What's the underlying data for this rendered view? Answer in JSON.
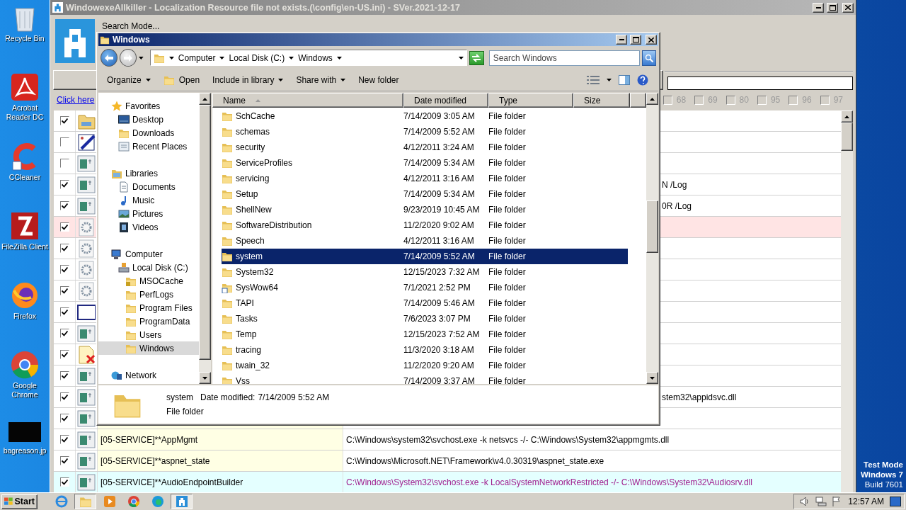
{
  "desktop_icons": [
    {
      "label": "Recycle Bin",
      "kind": "recycle"
    },
    {
      "label": "Acrobat Reader DC",
      "kind": "acrobat"
    },
    {
      "label": "CCleaner",
      "kind": "ccleaner"
    },
    {
      "label": "FileZilla Client",
      "kind": "filezilla"
    },
    {
      "label": "Firefox",
      "kind": "firefox"
    },
    {
      "label": "Google Chrome",
      "kind": "chrome"
    },
    {
      "label": "bagreason.jp",
      "kind": "image"
    }
  ],
  "app": {
    "title": "WindowexeAllkiller - Localization Resource file not exists.(\\config\\en-US.ini) - SVer.2021-12-17",
    "menu": "Search Mode...",
    "link": "Click here",
    "filters": [
      {
        "label": "68",
        "checked": false,
        "disabled": true
      },
      {
        "label": "69",
        "checked": false,
        "disabled": true
      },
      {
        "label": "80",
        "checked": false,
        "disabled": true
      },
      {
        "label": "95",
        "checked": false,
        "disabled": true
      },
      {
        "label": "96",
        "checked": false,
        "disabled": true
      },
      {
        "label": "97",
        "checked": false,
        "disabled": true
      }
    ],
    "rows": [
      {
        "checked": true,
        "kind": "plain",
        "icon": {
          "kind": "folder"
        }
      },
      {
        "checked": false,
        "kind": "plain",
        "icon": {
          "kind": "paint"
        }
      },
      {
        "checked": false,
        "kind": "plain",
        "icon": {
          "kind": "window"
        }
      },
      {
        "checked": true,
        "kind": "plain",
        "icon": {
          "kind": "window"
        },
        "path": "N /Log"
      },
      {
        "checked": true,
        "kind": "plain",
        "icon": {
          "kind": "window"
        },
        "path": "0R /Log"
      },
      {
        "checked": true,
        "kind": "flagged",
        "icon": {
          "kind": "gear"
        }
      },
      {
        "checked": true,
        "kind": "plain",
        "icon": {
          "kind": "gear"
        }
      },
      {
        "checked": true,
        "kind": "plain",
        "icon": {
          "kind": "gear"
        }
      },
      {
        "checked": true,
        "kind": "plain",
        "icon": {
          "kind": "gear"
        }
      },
      {
        "checked": true,
        "kind": "plain",
        "icon": {
          "kind": "blank"
        }
      },
      {
        "checked": true,
        "kind": "plain",
        "icon": {
          "kind": "window"
        }
      },
      {
        "checked": true,
        "kind": "plain",
        "icon": {
          "kind": "docx"
        }
      },
      {
        "checked": true,
        "kind": "plain",
        "icon": {
          "kind": "window"
        }
      },
      {
        "checked": true,
        "kind": "plain",
        "icon": {
          "kind": "window"
        },
        "path": "stem32\\appidsvc.dll"
      },
      {
        "checked": true,
        "kind": "service",
        "icon": {
          "kind": "window"
        }
      },
      {
        "checked": true,
        "kind": "service",
        "icon": {
          "kind": "window"
        },
        "name": "[05-SERVICE]**AppMgmt",
        "path": "C:\\Windows\\system32\\svchost.exe -k netsvcs -/- C:\\Windows\\System32\\appmgmts.dll"
      },
      {
        "checked": true,
        "kind": "service",
        "icon": {
          "kind": "window"
        },
        "name": "[05-SERVICE]**aspnet_state",
        "path": "C:\\Windows\\Microsoft.NET\\Framework\\v4.0.30319\\aspnet_state.exe"
      },
      {
        "checked": true,
        "kind": "restricted",
        "icon": {
          "kind": "window"
        },
        "name": "[05-SERVICE]**AudioEndpointBuilder",
        "path": "C:\\Windows\\System32\\svchost.exe -k LocalSystemNetworkRestricted -/- C:\\Windows\\System32\\Audiosrv.dll"
      }
    ]
  },
  "explorer": {
    "title": "Windows",
    "breadcrumb": [
      "Computer",
      "Local Disk (C:)",
      "Windows"
    ],
    "search": {
      "placeholder": "Search Windows"
    },
    "toolbar": [
      {
        "label": "Organize",
        "kind": "menu"
      },
      {
        "label": "Open",
        "kind": "icon"
      },
      {
        "label": "Include in library",
        "kind": "menu"
      },
      {
        "label": "Share with",
        "kind": "menu"
      },
      {
        "label": "New folder",
        "kind": "plain"
      }
    ],
    "nav": [
      {
        "label": "Favorites",
        "kind": "star",
        "selected": false,
        "children": [
          {
            "label": "Desktop",
            "kind": "desktop",
            "selected": false
          },
          {
            "label": "Downloads",
            "kind": "downloads",
            "selected": false
          },
          {
            "label": "Recent Places",
            "kind": "recent",
            "selected": false
          }
        ]
      },
      {
        "label": "Libraries",
        "kind": "library",
        "selected": false,
        "children": [
          {
            "label": "Documents",
            "kind": "document",
            "selected": false
          },
          {
            "label": "Music",
            "kind": "music",
            "selected": false
          },
          {
            "label": "Pictures",
            "kind": "picture",
            "selected": false
          },
          {
            "label": "Videos",
            "kind": "video",
            "selected": false
          }
        ]
      },
      {
        "label": "Computer",
        "kind": "computer",
        "selected": false,
        "children": [
          {
            "label": "Local Disk (C:)",
            "kind": "drive",
            "selected": false,
            "children": [
              {
                "label": "MSOCache",
                "kind": "lockfolder",
                "selected": false
              },
              {
                "label": "PerfLogs",
                "kind": "folder",
                "selected": false
              },
              {
                "label": "Program Files",
                "kind": "folder",
                "selected": false
              },
              {
                "label": "ProgramData",
                "kind": "folder",
                "selected": false
              },
              {
                "label": "Users",
                "kind": "folder",
                "selected": false
              },
              {
                "label": "Windows",
                "kind": "folder",
                "selected": true
              }
            ]
          }
        ]
      },
      {
        "label": "Network",
        "kind": "network",
        "selected": false
      }
    ],
    "columns": [
      {
        "label": "Name",
        "sorted": true
      },
      {
        "label": "Date modified",
        "sorted": false
      },
      {
        "label": "Type",
        "sorted": false
      },
      {
        "label": "Size",
        "sorted": false
      }
    ],
    "files": [
      {
        "name": "SchCache",
        "date": "7/14/2009 3:05 AM",
        "type": "File folder",
        "kind": "folder",
        "selected": false
      },
      {
        "name": "schemas",
        "date": "7/14/2009 5:52 AM",
        "type": "File folder",
        "kind": "folder",
        "selected": false
      },
      {
        "name": "security",
        "date": "4/12/2011 3:24 AM",
        "type": "File folder",
        "kind": "folder",
        "selected": false
      },
      {
        "name": "ServiceProfiles",
        "date": "7/14/2009 5:34 AM",
        "type": "File folder",
        "kind": "folder",
        "selected": false
      },
      {
        "name": "servicing",
        "date": "4/12/2011 3:16 AM",
        "type": "File folder",
        "kind": "folder",
        "selected": false
      },
      {
        "name": "Setup",
        "date": "7/14/2009 5:34 AM",
        "type": "File folder",
        "kind": "folder",
        "selected": false
      },
      {
        "name": "ShellNew",
        "date": "9/23/2019 10:45 AM",
        "type": "File folder",
        "kind": "folder",
        "selected": false
      },
      {
        "name": "SoftwareDistribution",
        "date": "11/2/2020 9:02 AM",
        "type": "File folder",
        "kind": "folder",
        "selected": false
      },
      {
        "name": "Speech",
        "date": "4/12/2011 3:16 AM",
        "type": "File folder",
        "kind": "folder",
        "selected": false
      },
      {
        "name": "system",
        "date": "7/14/2009 5:52 AM",
        "type": "File folder",
        "kind": "folder",
        "selected": true
      },
      {
        "name": "System32",
        "date": "12/15/2023 7:32 AM",
        "type": "File folder",
        "kind": "folder",
        "selected": false
      },
      {
        "name": "SysWow64",
        "date": "7/1/2021 2:52 PM",
        "type": "File folder",
        "kind": "shortcut",
        "selected": false
      },
      {
        "name": "TAPI",
        "date": "7/14/2009 5:46 AM",
        "type": "File folder",
        "kind": "folder",
        "selected": false
      },
      {
        "name": "Tasks",
        "date": "7/6/2023 3:07 PM",
        "type": "File folder",
        "kind": "folder",
        "selected": false
      },
      {
        "name": "Temp",
        "date": "12/15/2023 7:52 AM",
        "type": "File folder",
        "kind": "folder",
        "selected": false
      },
      {
        "name": "tracing",
        "date": "11/3/2020 3:18 AM",
        "type": "File folder",
        "kind": "folder",
        "selected": false
      },
      {
        "name": "twain_32",
        "date": "11/2/2020 9:20 AM",
        "type": "File folder",
        "kind": "folder",
        "selected": false
      },
      {
        "name": "Vss",
        "date": "7/14/2009 3:37 AM",
        "type": "File folder",
        "kind": "folder",
        "selected": false
      }
    ],
    "details": {
      "name": "system",
      "label": "Date modified:",
      "value": "7/14/2009 5:52 AM",
      "type": "File folder"
    }
  },
  "system_text": [
    "Test Mode",
    "Windows 7",
    "Build 7601"
  ],
  "taskbar": {
    "start": "Start",
    "items": [
      {
        "kind": "ie",
        "active": false
      },
      {
        "kind": "explorer",
        "active": true
      },
      {
        "kind": "media",
        "active": false
      },
      {
        "kind": "chrome",
        "active": false
      },
      {
        "kind": "edge",
        "active": false
      },
      {
        "kind": "app",
        "active": true
      }
    ],
    "time": "12:57 AM"
  }
}
